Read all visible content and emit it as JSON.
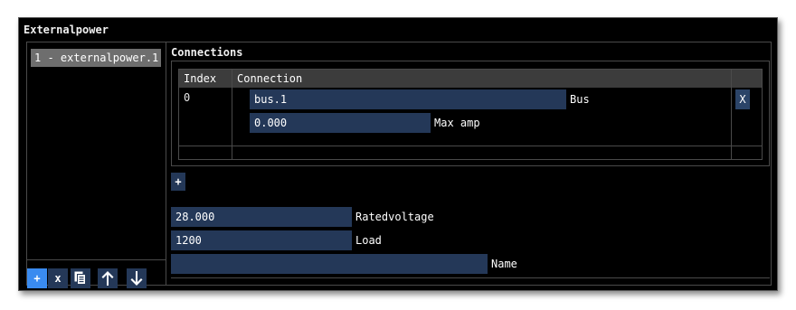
{
  "window": {
    "title": "Externalpower"
  },
  "list": {
    "items": [
      {
        "label": "1 - externalpower.1"
      }
    ]
  },
  "left_toolbar": {
    "add_label": "+",
    "remove_label": "x",
    "duplicate_icon": "copy-icon",
    "move_up_icon": "arrow-up-icon",
    "move_down_icon": "arrow-down-icon"
  },
  "connections": {
    "section_label": "Connections",
    "columns": [
      "Index",
      "Connection"
    ],
    "rows": [
      {
        "index": "0",
        "bus_value": "bus.1",
        "bus_label": "Bus",
        "maxamp_value": "0.000",
        "maxamp_label": "Max amp",
        "remove_label": "X"
      }
    ],
    "add_label": "+"
  },
  "properties": {
    "ratedvoltage_value": "28.000",
    "ratedvoltage_label": "Ratedvoltage",
    "load_value": "1200",
    "load_label": "Load",
    "name_value": "",
    "name_label": "Name"
  },
  "colors": {
    "panel_bg": "#000000",
    "field_bg": "#243858",
    "accent": "#3a8bf0",
    "selected_item": "#6e6e6e",
    "header_bg": "#3c3c3c"
  }
}
